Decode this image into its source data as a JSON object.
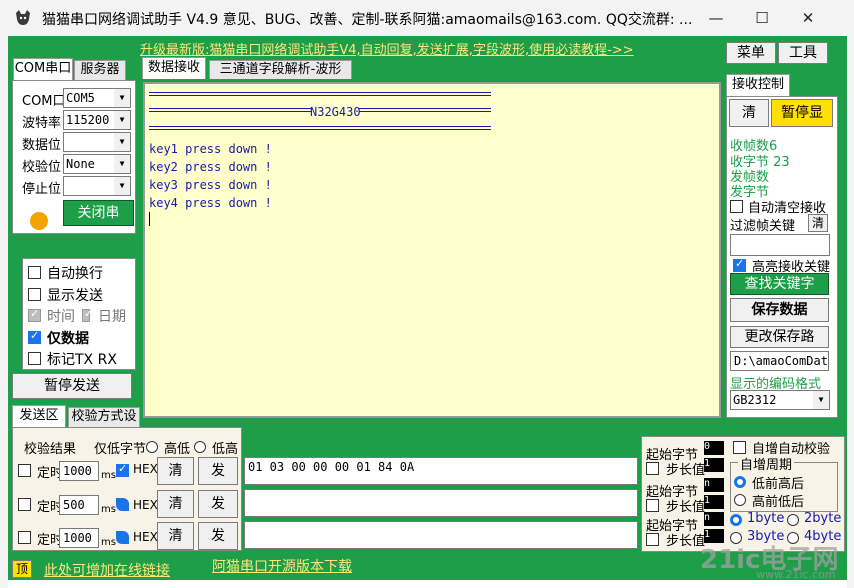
{
  "window": {
    "title": "猫猫串口网络调试助手 V4.9 意见、BUG、改善、定制-联系阿猫:amaomails@163.com. QQ交流群: ...",
    "minimize": "—",
    "maximize": "☐",
    "close": "✕"
  },
  "banner": {
    "text": "升级最新版:猫猫串口网络调试助手V4,自动回复,发送扩展,字段波形,使用必读教程->>"
  },
  "menu": {
    "menu_label": "菜单",
    "tools_label": "工具"
  },
  "left_tabs": {
    "com": "COM串口",
    "server": "服务器"
  },
  "port_settings": {
    "port_label": "COM口",
    "port_value": "COM5",
    "baud_label": "波特率",
    "baud_value": "115200",
    "data_bits_label": "数据位",
    "data_bits_value": "",
    "parity_label": "校验位",
    "parity_value": "None",
    "stop_bits_label": "停止位",
    "stop_bits_value": "",
    "close_port_label": "关闭串",
    "status_color": "#f5a300"
  },
  "options": {
    "auto_wrap": "自动换行",
    "show_send": "显示发送",
    "time": "时间",
    "date": "日期",
    "data_only": "仅数据",
    "mark_txrx": "标记TX RX"
  },
  "pause_send_label": "暂停发送",
  "center_tabs": {
    "recv": "数据接收",
    "three_channel": "三通道字段解析-波形"
  },
  "receive": {
    "header_center": "N32G430",
    "lines": [
      "key1 press down !",
      "key2 press down !",
      "key3 press down !",
      "key4 press down !"
    ]
  },
  "recv_control": {
    "tab_label": "接收控制",
    "clear_label": "清",
    "pause_label": "暂停显",
    "frames_label": "收帧数",
    "frames_value": "6",
    "bytes_label": "收字节",
    "bytes_value": "23",
    "send_frames_label": "发帧数",
    "send_bytes_label": "发字节",
    "auto_clear_label": "自动清空接收",
    "filter_label": "过滤帧关键",
    "filter_clear": "清",
    "highlight_label": "高亮接收关键",
    "find_keyword_label": "查找关键字",
    "save_data_label": "保存数据",
    "change_path_label": "更改保存路",
    "save_path": "D:\\amaoComData",
    "encoding_label": "显示的编码格式",
    "encoding_value": "GB2312"
  },
  "send_area": {
    "tab_send": "发送区",
    "tab_checksum": "校验方式设",
    "checksum_result": "校验结果",
    "low_byte_only": "仅低字节",
    "high_low": "高低",
    "low_high": "低高",
    "rows": [
      {
        "timer_label": "定时",
        "interval": "1000",
        "unit": "ms",
        "hex_label": "HEX",
        "clear": "清",
        "send": "发",
        "content": "01 03 00 00 00 01 84 0A"
      },
      {
        "timer_label": "定时",
        "interval": "500",
        "unit": "ms",
        "hex_label": "HEX",
        "clear": "清",
        "send": "发",
        "content": ""
      },
      {
        "timer_label": "定时",
        "interval": "1000",
        "unit": "ms",
        "hex_label": "HEX",
        "clear": "清",
        "send": "发",
        "content": ""
      }
    ]
  },
  "increment": {
    "start_byte": "起始字节",
    "step_len": "步长值",
    "start_val_1": "0",
    "step_val_1": "1",
    "start_val_2": "n",
    "step_val_2": "1",
    "start_val_3": "n",
    "step_val_3": "1",
    "auto_checksum": "自增自动校验",
    "period": "自增周期",
    "low_first": "低前高后",
    "high_first": "高前低后",
    "byte1": "1byte",
    "byte2": "2byte",
    "byte3": "3byte",
    "byte4": "4byte"
  },
  "bottom": {
    "top_button": "顶",
    "add_link": "此处可增加在线链接",
    "open_source": "阿猫串口开源版本下载",
    "watermark": "21ic电子网",
    "watermark_sub": "www.21ic.com"
  }
}
